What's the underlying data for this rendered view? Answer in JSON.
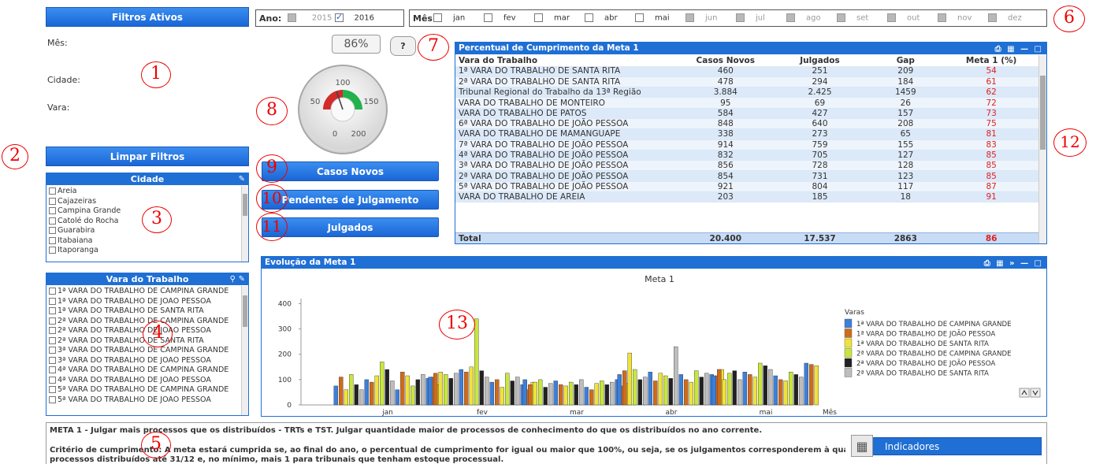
{
  "filters": {
    "title": "Filtros Ativos",
    "labels": [
      "Mês:",
      "Cidade:",
      "Vara:"
    ],
    "clear_label": "Limpar Filtros"
  },
  "ano": {
    "label": "Ano:",
    "years": [
      {
        "value": "2015",
        "checked": false,
        "disabled": true
      },
      {
        "value": "2016",
        "checked": true,
        "disabled": false
      }
    ]
  },
  "mes": {
    "label": "Mês:",
    "months": [
      {
        "name": "jan",
        "disabled": false
      },
      {
        "name": "fev",
        "disabled": false
      },
      {
        "name": "mar",
        "disabled": false
      },
      {
        "name": "abr",
        "disabled": false
      },
      {
        "name": "mai",
        "disabled": false
      },
      {
        "name": "jun",
        "disabled": true
      },
      {
        "name": "jul",
        "disabled": true
      },
      {
        "name": "ago",
        "disabled": true
      },
      {
        "name": "set",
        "disabled": true
      },
      {
        "name": "out",
        "disabled": true
      },
      {
        "name": "nov",
        "disabled": true
      },
      {
        "name": "dez",
        "disabled": true
      }
    ]
  },
  "cidade": {
    "title": "Cidade",
    "items": [
      "Areia",
      "Cajazeiras",
      "Campina Grande",
      "Catolé do Rocha",
      "Guarabira",
      "Itabaiana",
      "Itaporanga"
    ]
  },
  "vara": {
    "title": "Vara do Trabalho",
    "items": [
      "1ª VARA DO TRABALHO DE CAMPINA GRANDE",
      "1ª VARA DO TRABALHO DE JOÃO PESSOA",
      "1ª VARA DO TRABALHO DE SANTA RITA",
      "2ª VARA DO TRABALHO DE CAMPINA GRANDE",
      "2ª VARA DO TRABALHO DE JOÃO PESSOA",
      "2ª VARA DO TRABALHO DE SANTA RITA",
      "3ª VARA DO TRABALHO DE CAMPINA GRANDE",
      "3ª VARA DO TRABALHO DE JOÃO PESSOA",
      "4ª VARA DO TRABALHO DE CAMPINA GRANDE",
      "4ª VARA DO TRABALHO DE JOÃO PESSOA",
      "5ª VARA DO TRABALHO DE CAMPINA GRANDE",
      "5ª VARA DO TRABALHO DE JOÃO PESSOA"
    ]
  },
  "gauge": {
    "percent_label": "86%",
    "help_label": "?",
    "ticks": [
      "0",
      "50",
      "100",
      "150",
      "200"
    ],
    "value": 86,
    "min": 0,
    "max": 200
  },
  "buttons": {
    "casos_novos": "Casos Novos",
    "pendentes": "Pendentes de Julgamento",
    "julgados": "Julgados"
  },
  "table": {
    "title": "Percentual de Cumprimento da Meta 1",
    "columns": [
      "Vara do Trabalho",
      "Casos Novos",
      "Julgados",
      "Gap",
      "Meta 1 (%)"
    ],
    "rows": [
      [
        "1ª VARA DO TRABALHO DE SANTA RITA",
        "460",
        "251",
        "209",
        "54"
      ],
      [
        "2ª VARA DO TRABALHO DE SANTA RITA",
        "478",
        "294",
        "184",
        "61"
      ],
      [
        "Tribunal Regional do Trabalho da 13ª Região",
        "3.884",
        "2.425",
        "1459",
        "62"
      ],
      [
        "VARA DO TRABALHO DE MONTEIRO",
        "95",
        "69",
        "26",
        "72"
      ],
      [
        "VARA DO TRABALHO DE PATOS",
        "584",
        "427",
        "157",
        "73"
      ],
      [
        "6ª VARA DO TRABALHO DE JOÃO PESSOA",
        "848",
        "640",
        "208",
        "75"
      ],
      [
        "VARA DO TRABALHO DE MAMANGUAPE",
        "338",
        "273",
        "65",
        "81"
      ],
      [
        "7ª VARA DO TRABALHO DE JOÃO PESSOA",
        "914",
        "759",
        "155",
        "83"
      ],
      [
        "4ª VARA DO TRABALHO DE JOÃO PESSOA",
        "832",
        "705",
        "127",
        "85"
      ],
      [
        "3ª VARA DO TRABALHO DE JOÃO PESSOA",
        "856",
        "728",
        "128",
        "85"
      ],
      [
        "2ª VARA DO TRABALHO DE JOÃO PESSOA",
        "854",
        "731",
        "123",
        "85"
      ],
      [
        "5ª VARA DO TRABALHO DE JOÃO PESSOA",
        "921",
        "804",
        "117",
        "87"
      ],
      [
        "VARA DO TRABALHO DE AREIA",
        "203",
        "185",
        "18",
        "91"
      ]
    ],
    "total": [
      "Total",
      "20.400",
      "17.537",
      "2863",
      "86"
    ]
  },
  "evolucao": {
    "panel_title": "Evolução da Meta 1",
    "legend_title": "Varas"
  },
  "chart_data": {
    "type": "bar",
    "title": "Meta 1",
    "xlabel": "Mês",
    "ylabel": "",
    "ylim": [
      0,
      420
    ],
    "yticks": [
      0,
      100,
      200,
      300,
      400
    ],
    "categories": [
      "jan",
      "fev",
      "mar",
      "abr",
      "mai"
    ],
    "series": [
      {
        "name": "1ª VARA DO TRABALHO DE CAMPINA GRANDE",
        "color": "#3d7fd9"
      },
      {
        "name": "1ª VARA DO TRABALHO DE JOÃO PESSOA",
        "color": "#d06a1a"
      },
      {
        "name": "1ª VARA DO TRABALHO DE SANTA RITA",
        "color": "#f0e23a"
      },
      {
        "name": "2ª VARA DO TRABALHO DE CAMPINA GRANDE",
        "color": "#c8e63c"
      },
      {
        "name": "2ª VARA DO TRABALHO DE JOÃO PESSOA",
        "color": "#222222"
      },
      {
        "name": "2ª VARA DO TRABALHO DE SANTA RITA",
        "color": "#bdbdbd"
      }
    ],
    "groups": [
      [
        75,
        110,
        60,
        120,
        80,
        60,
        100,
        90,
        115,
        170,
        140,
        95,
        60,
        130,
        115,
        75,
        100,
        120,
        105,
        110,
        80
      ],
      [
        110,
        125,
        130,
        120,
        105,
        125,
        140,
        130,
        150,
        340,
        135,
        110,
        90,
        100,
        70,
        125,
        95,
        110,
        80,
        60,
        90
      ],
      [
        100,
        80,
        90,
        100,
        70,
        85,
        95,
        80,
        75,
        90,
        80,
        100,
        70,
        60,
        85,
        95,
        80,
        90,
        100,
        75,
        85
      ],
      [
        120,
        135,
        205,
        140,
        100,
        110,
        130,
        95,
        125,
        115,
        105,
        230,
        120,
        100,
        90,
        135,
        110,
        125,
        120,
        115,
        140
      ],
      [
        115,
        140,
        100,
        125,
        135,
        100,
        130,
        120,
        110,
        165,
        155,
        140,
        115,
        100,
        95,
        130,
        120,
        110,
        165,
        160,
        155
      ]
    ],
    "legend_position": "right"
  },
  "info": {
    "line1": "META 1 - Julgar mais processos que os distribuídos - TRTs e TST. Julgar quantidade maior de processos de conhecimento do que os distribuídos no ano corrente.",
    "line2": "Critério de cumprimento: A meta estará cumprida se, ao final do ano, o percentual de cumprimento for igual ou maior que 100%, ou seja, se os julgamentos corresponderem à quantidade de",
    "line3": "processos distribuídos até 31/12 e, no mínimo, mais 1 para tribunais que tenham estoque processual.",
    "indicadores_label": "Indicadores"
  },
  "annotations": [
    "1",
    "2",
    "3",
    "4",
    "5",
    "6",
    "7",
    "8",
    "9",
    "10",
    "11",
    "12",
    "13"
  ],
  "colors": {
    "accent": "#1f6fd4",
    "meta_red": "#e02020",
    "annotation_red": "#e00000"
  }
}
